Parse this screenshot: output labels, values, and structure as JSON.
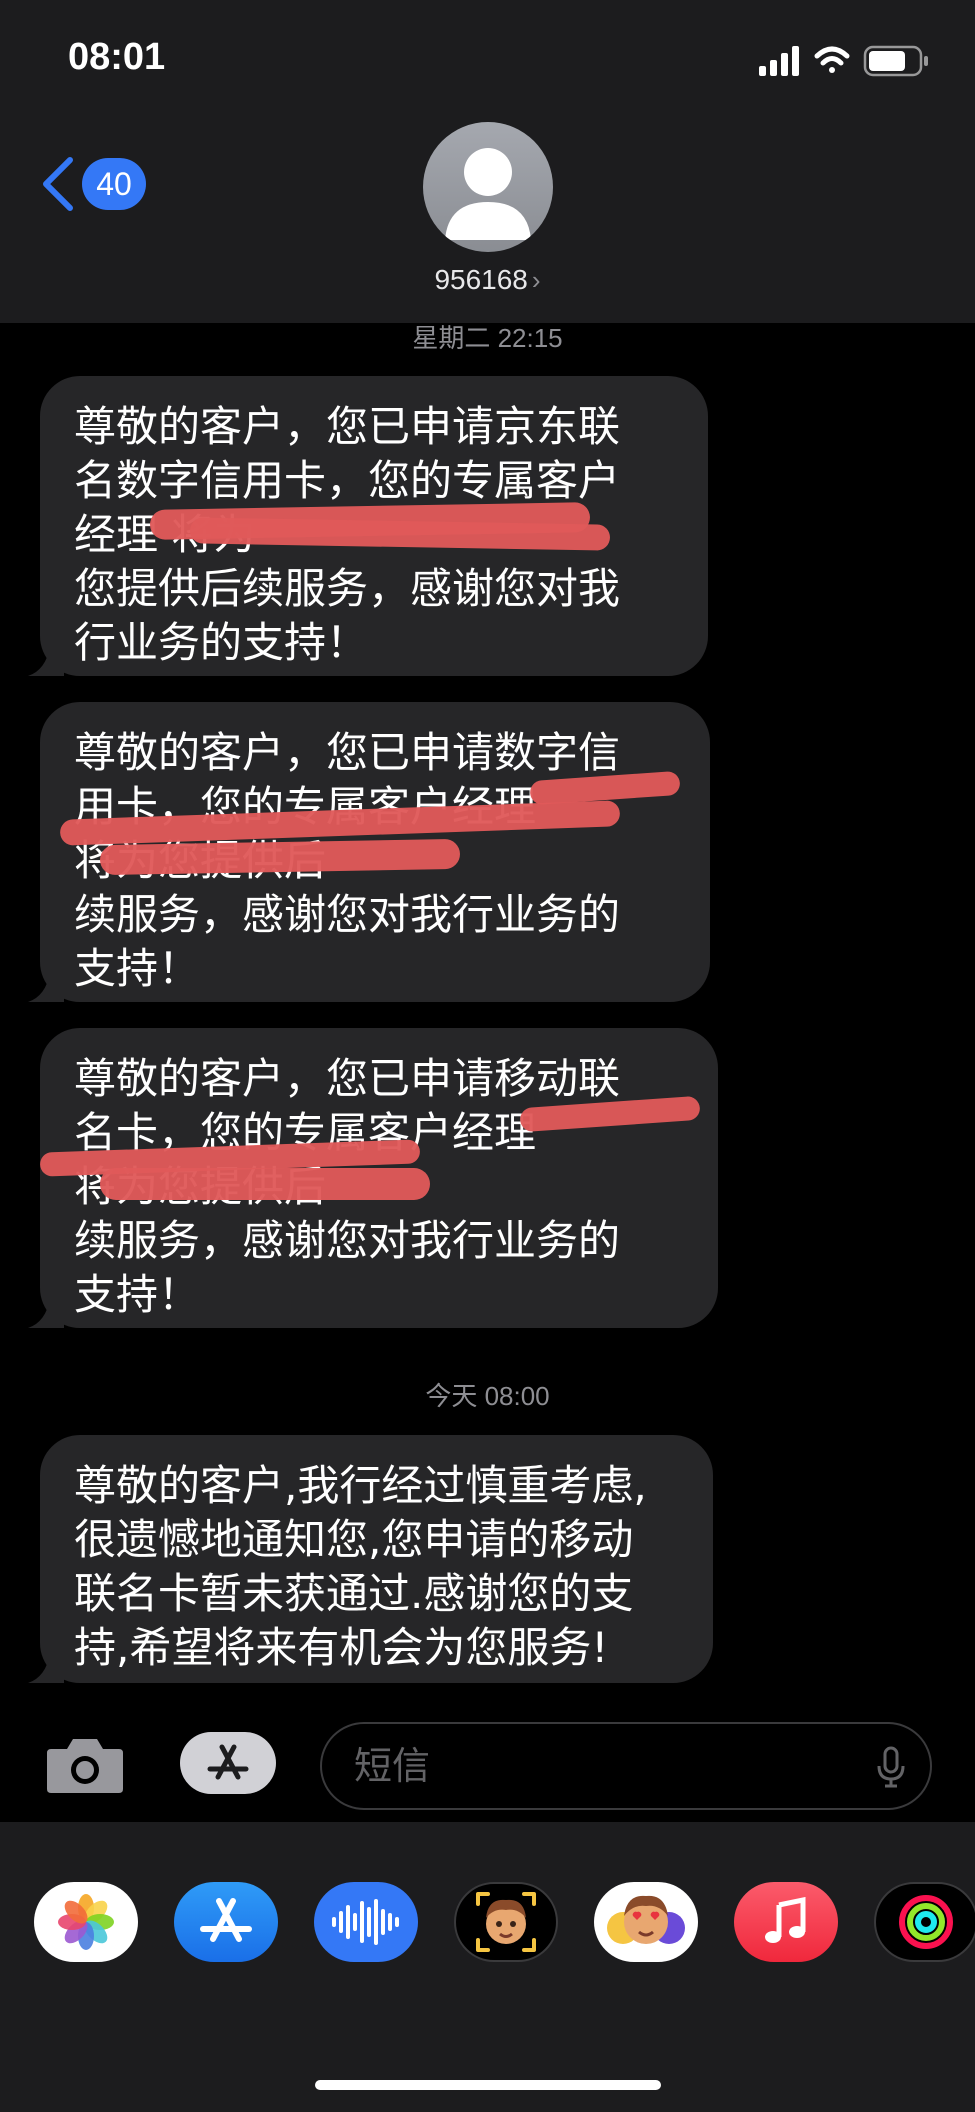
{
  "status_bar": {
    "time": "08:01"
  },
  "nav": {
    "back_count": "40",
    "contact_name": "956168",
    "contact_chevron": "›"
  },
  "messages": [
    {
      "timestamp": "星期二 22:15",
      "text": "尊敬的客户，您已申请京东联\n名数字信用卡，您的专属客户\n经理             将为\n您提供后续服务，感谢您对我\n行业务的支持！"
    },
    {
      "text": "尊敬的客户，您已申请数字信\n用卡，您的专属客户经理\n          将为您提供后\n续服务，感谢您对我行业务的\n支持！"
    },
    {
      "text": "尊敬的客户，您已申请移动联\n名卡，您的专属客户经理\n          将为您提供后\n续服务，感谢您对我行业务的\n支持！"
    },
    {
      "timestamp": "今天 08:00",
      "text": "尊敬的客户,我行经过慎重考虑,\n很遗憾地通知您,您申请的移动\n联名卡暂未获通过.感谢您的支\n持,希望将来有机会为您服务!"
    }
  ],
  "composer": {
    "placeholder": "短信"
  },
  "icons": {
    "camera": "camera-icon",
    "app_store_button": "app-store-icon",
    "mic": "microphone-icon",
    "drawer": [
      "photos-icon",
      "app-store-icon",
      "audio-message-icon",
      "memoji-icon",
      "memoji-stickers-icon",
      "music-icon",
      "activity-icon"
    ]
  },
  "colors": {
    "blue": "#3478f6",
    "bubble": "#262628",
    "header": "#1c1c1e",
    "redaction": "#e05a5a"
  }
}
